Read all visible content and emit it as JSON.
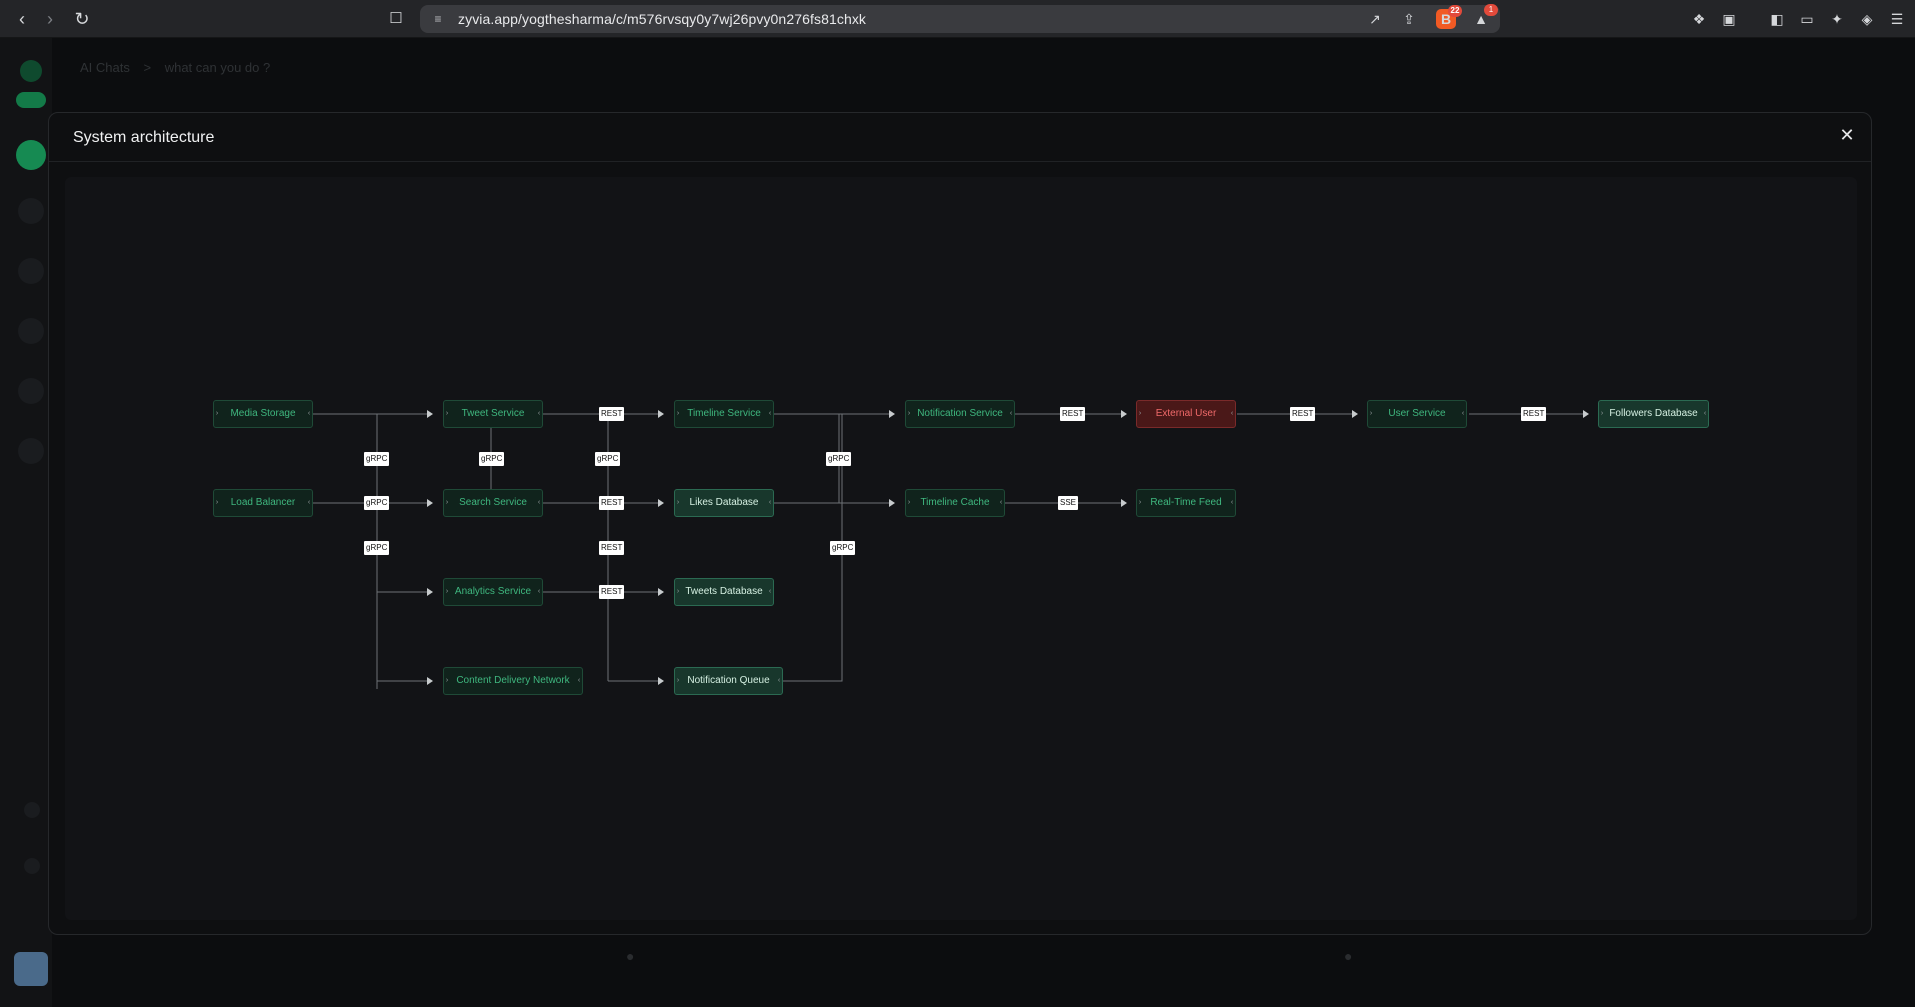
{
  "browser": {
    "url": "zyvia.app/yogthesharma/c/m576rvsqy0y7wj26pvy0n276fs81chxk",
    "brave_badge": "22",
    "alert_badge": "1",
    "icons": [
      "back-icon",
      "forward-icon",
      "reload-icon",
      "bookmark-icon",
      "site-settings-icon",
      "open-external-icon",
      "share-icon",
      "brave-shields-icon",
      "brave-rewards-icon",
      "extensions-icon",
      "reader-icon",
      "sidebar-icon",
      "wallet-icon",
      "leo-ai-icon",
      "vpn-icon",
      "menu-icon"
    ]
  },
  "background": {
    "breadcrumb_root": "AI Chats",
    "breadcrumb_sep": ">",
    "breadcrumb_current": "what can you do ?"
  },
  "modal": {
    "title": "System architecture",
    "close_label": "✕"
  },
  "diagram": {
    "nodes": [
      {
        "id": "media-storage",
        "label": "Media Storage",
        "kind": "svc"
      },
      {
        "id": "tweet-service",
        "label": "Tweet Service",
        "kind": "svc"
      },
      {
        "id": "timeline-service",
        "label": "Timeline Service",
        "kind": "svc"
      },
      {
        "id": "notification-service",
        "label": "Notification Service",
        "kind": "svc"
      },
      {
        "id": "external-user",
        "label": "External User",
        "kind": "ext"
      },
      {
        "id": "user-service",
        "label": "User Service",
        "kind": "svc"
      },
      {
        "id": "followers-database",
        "label": "Followers Database",
        "kind": "db"
      },
      {
        "id": "load-balancer",
        "label": "Load Balancer",
        "kind": "svc"
      },
      {
        "id": "search-service",
        "label": "Search Service",
        "kind": "svc"
      },
      {
        "id": "likes-database",
        "label": "Likes Database",
        "kind": "db"
      },
      {
        "id": "timeline-cache",
        "label": "Timeline Cache",
        "kind": "svc"
      },
      {
        "id": "real-time-feed",
        "label": "Real-Time Feed",
        "kind": "svc"
      },
      {
        "id": "analytics-service",
        "label": "Analytics Service",
        "kind": "svc"
      },
      {
        "id": "tweets-database",
        "label": "Tweets Database",
        "kind": "db"
      },
      {
        "id": "content-delivery-network",
        "label": "Content Delivery Network",
        "kind": "svc"
      },
      {
        "id": "notification-queue",
        "label": "Notification Queue",
        "kind": "db"
      }
    ],
    "edge_labels": {
      "grpc": "gRPC",
      "rest": "REST",
      "sse": "SSE"
    }
  }
}
